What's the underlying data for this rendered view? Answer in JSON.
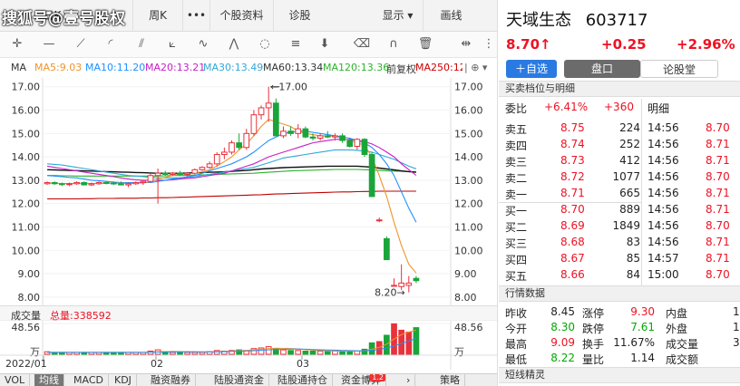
{
  "topbar": {
    "watermark": "搜狐号@壹号股权",
    "items": [
      "日K",
      "周K",
      "•••",
      "个股资料",
      "诊股",
      "显示 ▾",
      "画线"
    ]
  },
  "toolbar": {
    "icons": [
      "crosshair-icon",
      "line-icon",
      "ray-icon",
      "fan-icon",
      "channel-icon",
      "ruler-icon",
      "wave-icon",
      "cycle-icon",
      "fib-icon",
      "arrow-down-icon",
      "eraser-icon",
      "magnet-icon",
      "trash-icon",
      "split-icon",
      "more-icon"
    ]
  },
  "legend": {
    "label": "MA",
    "ma5": "MA5:9.03",
    "ma10": "MA10:11.20",
    "ma20": "MA20:13.21",
    "ma30": "MA30:13.49",
    "ma60": "MA60:13.34",
    "ma120": "MA120:13.36",
    "fq": "前复权",
    "extra": "MA250:12.53",
    "menu": "| ⊕ ▾"
  },
  "colors": {
    "up": "#e8323c",
    "down": "#1aa53a",
    "ma5": "#f0932a",
    "ma10": "#1e90ff",
    "ma20": "#c71fc7",
    "ma30": "#31a9d8",
    "ma60": "#111111",
    "ma120": "#2bb32b",
    "ma250": "#c00000",
    "vol_ma1": "#f0932a",
    "vol_ma2": "#1e90ff"
  },
  "chart_data": {
    "type": "candlestick",
    "y_ticks": [
      "17.00",
      "16.00",
      "15.00",
      "14.00",
      "13.00",
      "12.00",
      "11.00",
      "10.00",
      "9.00",
      "8.00"
    ],
    "ylim": [
      7.8,
      17.3
    ],
    "high_label": "17.00",
    "low_label": "8.20",
    "x_labels": [
      "2022/01",
      "02",
      "03"
    ],
    "candles": [
      [
        12.85,
        12.95,
        12.8,
        12.9
      ],
      [
        12.9,
        12.95,
        12.8,
        12.85
      ],
      [
        12.85,
        12.9,
        12.75,
        12.82
      ],
      [
        12.82,
        12.9,
        12.75,
        12.85
      ],
      [
        12.85,
        12.95,
        12.8,
        12.9
      ],
      [
        12.9,
        12.95,
        12.78,
        12.8
      ],
      [
        12.8,
        12.9,
        12.75,
        12.85
      ],
      [
        12.85,
        12.95,
        12.8,
        12.9
      ],
      [
        12.9,
        12.95,
        12.82,
        12.88
      ],
      [
        12.88,
        12.95,
        12.8,
        12.85
      ],
      [
        12.85,
        12.95,
        12.78,
        12.8
      ],
      [
        12.8,
        12.9,
        12.7,
        12.85
      ],
      [
        12.85,
        12.95,
        12.8,
        12.9
      ],
      [
        12.9,
        13.0,
        12.8,
        12.95
      ],
      [
        12.95,
        13.3,
        12.9,
        13.2
      ],
      [
        13.2,
        13.5,
        12.0,
        13.3
      ],
      [
        13.3,
        13.4,
        13.2,
        13.25
      ],
      [
        13.25,
        13.35,
        13.2,
        13.3
      ],
      [
        13.3,
        13.4,
        13.2,
        13.25
      ],
      [
        13.25,
        13.35,
        13.15,
        13.3
      ],
      [
        13.3,
        13.5,
        13.25,
        13.45
      ],
      [
        13.45,
        13.6,
        13.4,
        13.55
      ],
      [
        13.55,
        13.8,
        13.5,
        13.7
      ],
      [
        13.7,
        14.2,
        13.6,
        14.1
      ],
      [
        14.1,
        14.4,
        13.9,
        14.2
      ],
      [
        14.2,
        14.7,
        14.1,
        14.6
      ],
      [
        14.6,
        15.0,
        14.3,
        14.4
      ],
      [
        14.4,
        15.2,
        14.3,
        15.0
      ],
      [
        15.0,
        16.0,
        14.9,
        15.8
      ],
      [
        15.8,
        16.2,
        15.6,
        16.1
      ],
      [
        16.1,
        17.0,
        15.5,
        16.3
      ],
      [
        16.3,
        16.5,
        15.0,
        14.9
      ],
      [
        14.9,
        15.3,
        14.8,
        15.1
      ],
      [
        15.1,
        15.3,
        14.9,
        15.0
      ],
      [
        15.0,
        15.4,
        14.8,
        15.2
      ],
      [
        15.2,
        15.3,
        14.8,
        14.85
      ],
      [
        14.85,
        15.0,
        14.7,
        14.8
      ],
      [
        14.8,
        15.0,
        14.7,
        14.9
      ],
      [
        14.9,
        15.1,
        14.8,
        14.85
      ],
      [
        14.85,
        15.0,
        14.7,
        14.9
      ],
      [
        14.9,
        15.0,
        14.6,
        14.7
      ],
      [
        14.7,
        14.8,
        14.4,
        14.45
      ],
      [
        14.45,
        14.8,
        14.3,
        14.75
      ],
      [
        14.75,
        14.8,
        14.0,
        14.1
      ],
      [
        14.1,
        14.2,
        12.3,
        12.3
      ],
      [
        11.3,
        11.4,
        11.2,
        11.3
      ],
      [
        10.5,
        10.6,
        9.6,
        9.6
      ],
      [
        8.5,
        8.8,
        8.45,
        8.5
      ],
      [
        8.45,
        9.4,
        8.3,
        8.6
      ],
      [
        8.5,
        8.9,
        8.2,
        8.6
      ],
      [
        8.8,
        8.9,
        8.6,
        8.7
      ]
    ],
    "ma_lines": {
      "ma5": [
        12.88,
        12.87,
        12.86,
        12.86,
        12.86,
        12.87,
        12.86,
        12.86,
        12.87,
        12.87,
        12.87,
        12.86,
        12.86,
        12.88,
        12.94,
        13.05,
        13.12,
        13.2,
        13.26,
        13.26,
        13.31,
        13.36,
        13.45,
        13.6,
        13.8,
        14.0,
        14.3,
        14.55,
        14.9,
        15.3,
        15.6,
        15.5,
        15.4,
        15.3,
        15.1,
        15.0,
        14.95,
        14.9,
        14.9,
        14.88,
        14.8,
        14.7,
        14.6,
        14.5,
        14.0,
        13.2,
        12.3,
        11.2,
        10.2,
        9.4,
        9.03
      ],
      "ma10": [
        13.2,
        13.18,
        13.15,
        13.12,
        13.1,
        13.05,
        13.0,
        12.98,
        12.95,
        12.92,
        12.9,
        12.9,
        12.9,
        12.9,
        12.9,
        12.95,
        13.0,
        13.05,
        13.1,
        13.15,
        13.2,
        13.3,
        13.4,
        13.5,
        13.6,
        13.7,
        13.85,
        14.0,
        14.2,
        14.45,
        14.7,
        14.85,
        15.0,
        15.05,
        15.1,
        15.1,
        15.05,
        15.0,
        14.95,
        14.9,
        14.85,
        14.8,
        14.7,
        14.6,
        14.4,
        14.1,
        13.7,
        13.2,
        12.5,
        11.8,
        11.2
      ],
      "ma20": [
        13.6,
        13.55,
        13.5,
        13.45,
        13.4,
        13.35,
        13.3,
        13.25,
        13.2,
        13.15,
        13.1,
        13.05,
        13.02,
        13.0,
        13.0,
        13.0,
        13.0,
        13.02,
        13.05,
        13.08,
        13.1,
        13.15,
        13.2,
        13.25,
        13.3,
        13.4,
        13.5,
        13.6,
        13.7,
        13.85,
        14.0,
        14.1,
        14.2,
        14.3,
        14.4,
        14.5,
        14.6,
        14.65,
        14.7,
        14.75,
        14.75,
        14.75,
        14.7,
        14.65,
        14.55,
        14.4,
        14.2,
        14.0,
        13.7,
        13.45,
        13.21
      ],
      "ma30": [
        13.7,
        13.68,
        13.65,
        13.6,
        13.55,
        13.5,
        13.45,
        13.4,
        13.35,
        13.3,
        13.25,
        13.2,
        13.18,
        13.15,
        13.12,
        13.1,
        13.1,
        13.1,
        13.1,
        13.12,
        13.15,
        13.2,
        13.25,
        13.3,
        13.35,
        13.4,
        13.45,
        13.5,
        13.55,
        13.65,
        13.75,
        13.85,
        13.95,
        14.0,
        14.05,
        14.1,
        14.15,
        14.2,
        14.25,
        14.3,
        14.3,
        14.3,
        14.28,
        14.25,
        14.2,
        14.1,
        14.0,
        13.9,
        13.75,
        13.6,
        13.49
      ],
      "ma60": [
        13.45,
        13.44,
        13.43,
        13.42,
        13.41,
        13.4,
        13.39,
        13.38,
        13.37,
        13.36,
        13.35,
        13.34,
        13.33,
        13.32,
        13.31,
        13.3,
        13.3,
        13.3,
        13.3,
        13.31,
        13.32,
        13.33,
        13.34,
        13.35,
        13.36,
        13.38,
        13.4,
        13.42,
        13.45,
        13.48,
        13.5,
        13.52,
        13.54,
        13.55,
        13.56,
        13.57,
        13.58,
        13.59,
        13.6,
        13.6,
        13.6,
        13.6,
        13.6,
        13.58,
        13.56,
        13.52,
        13.48,
        13.44,
        13.4,
        13.37,
        13.34
      ],
      "ma120": [
        13.2,
        13.2,
        13.19,
        13.19,
        13.18,
        13.18,
        13.18,
        13.18,
        13.18,
        13.18,
        13.18,
        13.18,
        13.18,
        13.18,
        13.18,
        13.18,
        13.19,
        13.2,
        13.2,
        13.21,
        13.22,
        13.23,
        13.24,
        13.25,
        13.26,
        13.27,
        13.28,
        13.29,
        13.3,
        13.32,
        13.34,
        13.36,
        13.38,
        13.4,
        13.41,
        13.42,
        13.43,
        13.44,
        13.45,
        13.46,
        13.46,
        13.46,
        13.46,
        13.45,
        13.44,
        13.42,
        13.4,
        13.39,
        13.38,
        13.37,
        13.36
      ],
      "ma250": [
        12.2,
        12.2,
        12.2,
        12.2,
        12.2,
        12.21,
        12.21,
        12.22,
        12.22,
        12.22,
        12.23,
        12.23,
        12.23,
        12.24,
        12.24,
        12.25,
        12.25,
        12.26,
        12.27,
        12.28,
        12.29,
        12.3,
        12.31,
        12.32,
        12.33,
        12.34,
        12.35,
        12.36,
        12.37,
        12.38,
        12.4,
        12.41,
        12.42,
        12.43,
        12.44,
        12.45,
        12.46,
        12.47,
        12.48,
        12.49,
        12.5,
        12.5,
        12.51,
        12.52,
        12.52,
        12.53,
        12.53,
        12.53,
        12.53,
        12.53,
        12.53
      ]
    },
    "volume": {
      "label": "成交量",
      "total": "总量:338592",
      "y_tick": "48.56",
      "unit": "万",
      "values": [
        4,
        3,
        3,
        3,
        3,
        3,
        3,
        3,
        3,
        3,
        3,
        3,
        3,
        3,
        5,
        7,
        4,
        3,
        3,
        3,
        3,
        3,
        4,
        6,
        5,
        6,
        7,
        6,
        9,
        10,
        12,
        9,
        7,
        6,
        6,
        5,
        5,
        5,
        5,
        5,
        5,
        5,
        5,
        8,
        18,
        20,
        30,
        48,
        38,
        35,
        42
      ],
      "ma1": [
        3,
        3,
        3,
        3,
        3,
        3,
        3,
        3,
        3,
        3,
        3,
        3,
        3,
        3,
        3.5,
        4,
        4.2,
        4.4,
        4.3,
        4.2,
        4,
        3.6,
        3.5,
        4,
        4.5,
        5,
        5.6,
        6.2,
        7,
        8,
        9,
        9.5,
        9.4,
        9.2,
        8.5,
        7.4,
        6.5,
        5.8,
        5.4,
        5.2,
        5,
        5,
        5,
        5.6,
        8,
        11,
        16,
        24,
        31,
        35,
        38
      ],
      "ma2": [
        3,
        3,
        3,
        3,
        3,
        3,
        3,
        3,
        3,
        3,
        3,
        3,
        3,
        3,
        3.2,
        3.5,
        3.7,
        3.8,
        3.9,
        3.9,
        3.9,
        3.8,
        3.8,
        3.9,
        4.1,
        4.4,
        4.8,
        5.2,
        5.7,
        6.4,
        7,
        7.5,
        7.9,
        8.1,
        8.2,
        8,
        7.6,
        7.2,
        6.8,
        6.5,
        6.2,
        5.9,
        5.6,
        5.4,
        6.4,
        7.6,
        10,
        13.2,
        17,
        21,
        25
      ]
    }
  },
  "tabs": [
    {
      "label": "VOL",
      "active": false
    },
    {
      "label": "均线",
      "active": true
    },
    {
      "label": "MACD",
      "active": false
    },
    {
      "label": "KDJ",
      "active": false
    },
    {
      "label": "融资融券",
      "active": false
    },
    {
      "label": "陆股通资金",
      "active": false
    },
    {
      "label": "陆股通持仓",
      "active": false
    },
    {
      "label": "资金博弈",
      "active": false,
      "badge": "1.2"
    },
    {
      "label": "›",
      "active": false
    },
    {
      "label": "策略",
      "active": false
    }
  ],
  "stock": {
    "name": "天域生态",
    "code": "603717",
    "price": "8.70",
    "arrow": "↑",
    "change": "+0.25",
    "pct": "+2.96%"
  },
  "buttons": {
    "add": "＋自选",
    "seg1": "盘口",
    "seg2": "论股堂"
  },
  "depth": {
    "title": "买卖档位与明细",
    "wb_label": "委比",
    "wb_pct": "+6.41%",
    "wb_val": "+360",
    "detail_label": "明细",
    "rows": [
      {
        "lbl": "卖五",
        "price": "8.75",
        "vol": "224"
      },
      {
        "lbl": "卖四",
        "price": "8.74",
        "vol": "252"
      },
      {
        "lbl": "卖三",
        "price": "8.73",
        "vol": "412"
      },
      {
        "lbl": "卖二",
        "price": "8.72",
        "vol": "1077"
      },
      {
        "lbl": "卖一",
        "price": "8.71",
        "vol": "665"
      },
      {
        "lbl": "买一",
        "price": "8.70",
        "vol": "889"
      },
      {
        "lbl": "买二",
        "price": "8.69",
        "vol": "1849"
      },
      {
        "lbl": "买三",
        "price": "8.68",
        "vol": "83"
      },
      {
        "lbl": "买四",
        "price": "8.67",
        "vol": "85"
      },
      {
        "lbl": "买五",
        "price": "8.66",
        "vol": "84"
      }
    ],
    "ticks": [
      {
        "t": "14:56",
        "p": "8.70"
      },
      {
        "t": "14:56",
        "p": "8.71"
      },
      {
        "t": "14:56",
        "p": "8.71"
      },
      {
        "t": "14:56",
        "p": "8.70"
      },
      {
        "t": "14:56",
        "p": "8.71"
      },
      {
        "t": "14:56",
        "p": "8.71"
      },
      {
        "t": "14:56",
        "p": "8.70"
      },
      {
        "t": "14:56",
        "p": "8.71"
      },
      {
        "t": "14:57",
        "p": "8.71"
      },
      {
        "t": "15:00",
        "p": "8.70"
      }
    ]
  },
  "quote": {
    "title": "行情数据",
    "rows": [
      [
        [
          "昨收",
          "8.45",
          "blk"
        ],
        [
          "涨停",
          "9.30",
          "red"
        ],
        [
          "内盘",
          "1",
          ""
        ]
      ],
      [
        [
          "今开",
          "8.30",
          "green"
        ],
        [
          "跌停",
          "7.61",
          "green"
        ],
        [
          "外盘",
          "1",
          ""
        ]
      ],
      [
        [
          "最高",
          "9.09",
          "red"
        ],
        [
          "换手",
          "11.67%",
          "blk"
        ],
        [
          "成交量",
          "3",
          ""
        ]
      ],
      [
        [
          "最低",
          "8.22",
          "green"
        ],
        [
          "量比",
          "1.14",
          "blk"
        ],
        [
          "成交额",
          "",
          ""
        ]
      ]
    ]
  },
  "short": {
    "title": "短线精灵"
  }
}
